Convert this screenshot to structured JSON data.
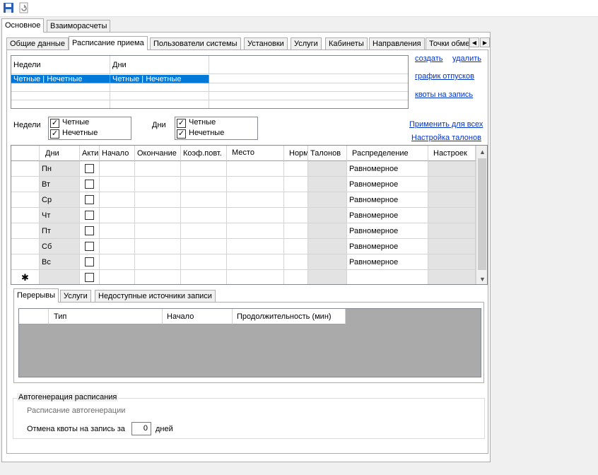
{
  "toolbar": {
    "save_icon": "save-icon",
    "refresh_icon": "refresh-icon"
  },
  "main_tabs": [
    {
      "label": "Основное"
    },
    {
      "label": "Взаиморасчеты"
    }
  ],
  "sub_tabs": [
    {
      "label": "Общие данные"
    },
    {
      "label": "Расписание приема"
    },
    {
      "label": "Пользователи системы"
    },
    {
      "label": "Установки"
    },
    {
      "label": "Услуги"
    },
    {
      "label": "Кабинеты"
    },
    {
      "label": "Направления"
    },
    {
      "label": "Точки обме"
    }
  ],
  "weeks_grid": {
    "headers": [
      "Недели",
      "Дни"
    ],
    "rows": [
      [
        "Четные | Нечетные",
        "Четные | Нечетные"
      ]
    ]
  },
  "links": {
    "create": "создать",
    "delete": "удалить",
    "vacation_schedule": "график отпусков",
    "quotas": "квоты на запись",
    "apply_all": "Применить для всех",
    "ticket_settings": "Настройка талонов"
  },
  "filters": {
    "weeks_label": "Недели",
    "days_label": "Дни",
    "weeks": [
      {
        "label": "Четные",
        "checked": true
      },
      {
        "label": "Нечетные",
        "checked": true
      }
    ],
    "days": [
      {
        "label": "Четные",
        "checked": true
      },
      {
        "label": "Нечетные",
        "checked": true
      }
    ]
  },
  "schedule": {
    "columns": [
      "Дни",
      "Актив",
      "Начало",
      "Окончание",
      "Коэф.повт.",
      "Место",
      "Норм",
      "Талонов",
      "Распределение",
      "Настроек"
    ],
    "rows": [
      {
        "day": "Пн",
        "distribution": "Равномерное"
      },
      {
        "day": "Вт",
        "distribution": "Равномерное"
      },
      {
        "day": "Ср",
        "distribution": "Равномерное"
      },
      {
        "day": "Чт",
        "distribution": "Равномерное"
      },
      {
        "day": "Пт",
        "distribution": "Равномерное"
      },
      {
        "day": "Сб",
        "distribution": "Равномерное"
      },
      {
        "day": "Вс",
        "distribution": "Равномерное"
      }
    ],
    "new_row_marker": "✱"
  },
  "bottom_tabs": [
    {
      "label": "Перерывы"
    },
    {
      "label": "Услуги"
    },
    {
      "label": "Недоступные источники записи"
    }
  ],
  "breaks_grid": {
    "columns": [
      "Тип",
      "Начало",
      "Продолжительность (мин)"
    ]
  },
  "autogen": {
    "group_title": "Автогенерация расписания",
    "schedule_label": "Расписание автогенерации",
    "quota_cancel_label": "Отмена квоты на запись за",
    "quota_cancel_value": "0",
    "days_label": "дней"
  }
}
